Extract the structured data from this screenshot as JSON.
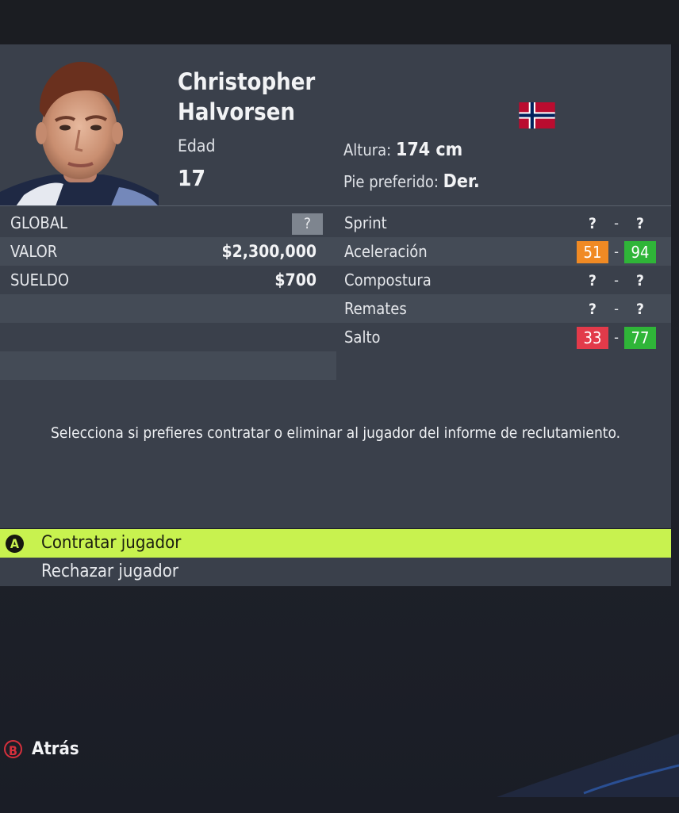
{
  "player": {
    "first_name": "Christopher",
    "last_name": "Halvorsen",
    "age_label": "Edad",
    "age": "17",
    "height_label": "Altura:",
    "height": "174 cm",
    "foot_label": "Pie preferido:",
    "foot": "Der.",
    "nationality_flag": "norway-flag"
  },
  "left_stats": [
    {
      "label": "GLOBAL",
      "value": "?"
    },
    {
      "label": "VALOR",
      "value": "$2,300,000"
    },
    {
      "label": "SUELDO",
      "value": "$700"
    }
  ],
  "right_stats": [
    {
      "label": "Sprint",
      "min": "?",
      "max": "?",
      "sep": "-"
    },
    {
      "label": "Aceleración",
      "min": "51",
      "max": "94",
      "sep": "-",
      "min_color": "#f08a24",
      "max_color": "#2fb538"
    },
    {
      "label": "Compostura",
      "min": "?",
      "max": "?",
      "sep": "-"
    },
    {
      "label": "Remates",
      "min": "?",
      "max": "?",
      "sep": "-"
    },
    {
      "label": "Salto",
      "min": "33",
      "max": "77",
      "sep": "-",
      "min_color": "#e23a4a",
      "max_color": "#2fb538"
    }
  ],
  "info_text": "Selecciona si prefieres contratar o eliminar al jugador del informe de reclutamiento.",
  "menu": {
    "hire": {
      "button": "A",
      "label": "Contratar jugador"
    },
    "reject": {
      "label": "Rechazar jugador"
    }
  },
  "footer": {
    "button": "B",
    "label": "Atrás"
  },
  "colors": {
    "accent": "#c8f24f",
    "panel": "#3a404b",
    "row_alt": "#444b56"
  }
}
